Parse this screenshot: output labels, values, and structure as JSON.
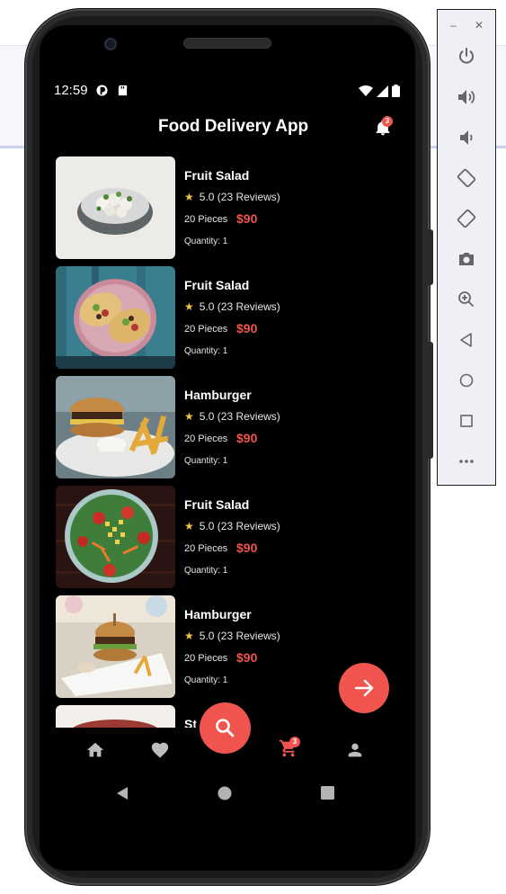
{
  "status_bar": {
    "time": "12:59"
  },
  "header": {
    "title": "Food Delivery App",
    "notification_count": "3"
  },
  "items": [
    {
      "name": "Fruit Salad",
      "rating_text": "5.0 (23 Reviews)",
      "pieces": "20 Pieces",
      "price": "$90",
      "quantity": "Quantity: 1"
    },
    {
      "name": "Fruit Salad",
      "rating_text": "5.0 (23 Reviews)",
      "pieces": "20 Pieces",
      "price": "$90",
      "quantity": "Quantity: 1"
    },
    {
      "name": "Hamburger",
      "rating_text": "5.0 (23 Reviews)",
      "pieces": "20 Pieces",
      "price": "$90",
      "quantity": "Quantity: 1"
    },
    {
      "name": "Fruit Salad",
      "rating_text": "5.0 (23 Reviews)",
      "pieces": "20 Pieces",
      "price": "$90",
      "quantity": "Quantity: 1"
    },
    {
      "name": "Hamburger",
      "rating_text": "5.0 (23 Reviews)",
      "pieces": "20 Pieces",
      "price": "$90",
      "quantity": "Quantity: 1"
    },
    {
      "name": "Ste"
    }
  ],
  "bottom_nav": {
    "cart_count": "3"
  },
  "colors": {
    "accent": "#f0544f",
    "star": "#f6c445",
    "background": "#000000"
  },
  "icons": [
    "home-icon",
    "heart-icon",
    "search-icon",
    "cart-icon",
    "person-icon",
    "bell-icon",
    "arrow-right-icon"
  ]
}
